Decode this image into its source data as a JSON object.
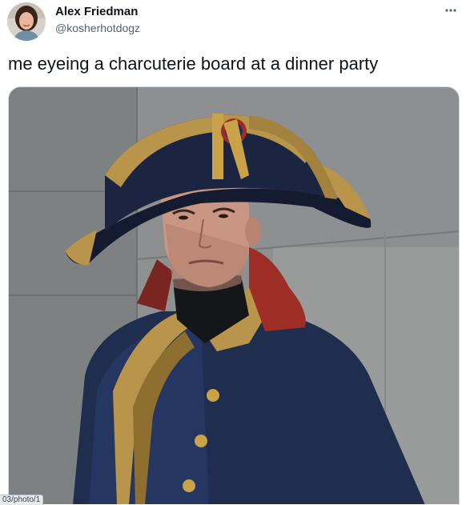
{
  "tweet": {
    "author": {
      "display_name": "Alex Friedman",
      "handle": "@kosherhotdogz",
      "avatar_icon": "profile-photo"
    },
    "more_icon": "ellipsis-icon",
    "text": "me eyeing a charcuterie board at a dinner party",
    "media": {
      "alt": "Man in a Napoleon bicorne hat and blue military coat with gold embroidery, side-eyeing",
      "icon": "photo"
    }
  },
  "status_bar": {
    "url_fragment": "03/photo/1"
  },
  "colors": {
    "text_primary": "#0f1419",
    "text_secondary": "#536471",
    "border": "#cfd9de"
  }
}
